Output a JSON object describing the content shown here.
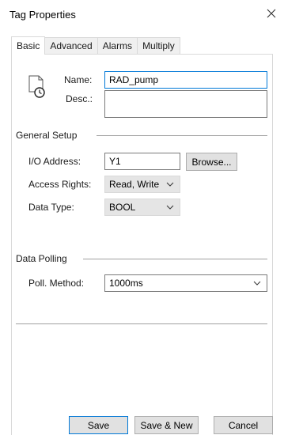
{
  "window": {
    "title": "Tag Properties"
  },
  "tabs": [
    {
      "label": "Basic",
      "active": true
    },
    {
      "label": "Advanced",
      "active": false
    },
    {
      "label": "Alarms",
      "active": false
    },
    {
      "label": "Multiply",
      "active": false
    }
  ],
  "basic": {
    "name_label": "Name:",
    "name_value": "RAD_pump",
    "desc_label": "Desc.:",
    "desc_value": "",
    "general_setup": {
      "title": "General Setup",
      "io_address_label": "I/O Address:",
      "io_address_value": "Y1",
      "browse_label": "Browse...",
      "access_rights_label": "Access Rights:",
      "access_rights_value": "Read, Write",
      "data_type_label": "Data Type:",
      "data_type_value": "BOOL"
    },
    "data_polling": {
      "title": "Data Polling",
      "poll_method_label": "Poll. Method:",
      "poll_method_value": "1000ms"
    }
  },
  "buttons": {
    "save": "Save",
    "save_new": "Save & New",
    "cancel": "Cancel"
  },
  "icons": {
    "close": "close-icon",
    "tag": "tag-document-clock-icon",
    "dropdown": "chevron-down-icon"
  },
  "colors": {
    "accent": "#0078d7",
    "border": "#d9d9d9",
    "button_face": "#e1e1e1",
    "combo_face": "#e5e5e5"
  }
}
